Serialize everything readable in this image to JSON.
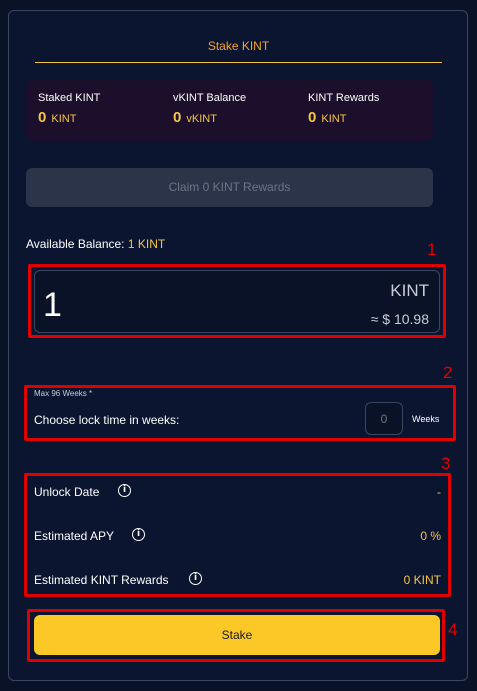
{
  "tab": {
    "title": "Stake KINT"
  },
  "stats": {
    "staked": {
      "label": "Staked KINT",
      "value": "0",
      "unit": "KINT"
    },
    "vkint": {
      "label": "vKINT Balance",
      "value": "0",
      "unit": "vKINT"
    },
    "rewards": {
      "label": "KINT Rewards",
      "value": "0",
      "unit": "KINT"
    }
  },
  "claim": {
    "label": "Claim 0 KINT Rewards"
  },
  "balance": {
    "label": "Available Balance:",
    "value": "1 KINT"
  },
  "amount": {
    "value": "1",
    "currency": "KINT",
    "usd": "≈ $ 10.98"
  },
  "lock": {
    "max_label": "Max 96 Weeks *",
    "label": "Choose lock time in weeks:",
    "placeholder": "0",
    "unit": "Weeks"
  },
  "info": {
    "unlock_date": {
      "label": "Unlock Date",
      "value": "-"
    },
    "apy": {
      "label": "Estimated APY",
      "value": "0 %"
    },
    "rewards": {
      "label": "Estimated KINT Rewards",
      "value": "0 KINT"
    }
  },
  "stake": {
    "label": "Stake"
  },
  "annotations": [
    "1",
    "2",
    "3",
    "4"
  ],
  "colors": {
    "accent": "#f5c542",
    "annotation": "#e00000",
    "background": "#0b1530",
    "stake_button": "#fbc828"
  }
}
